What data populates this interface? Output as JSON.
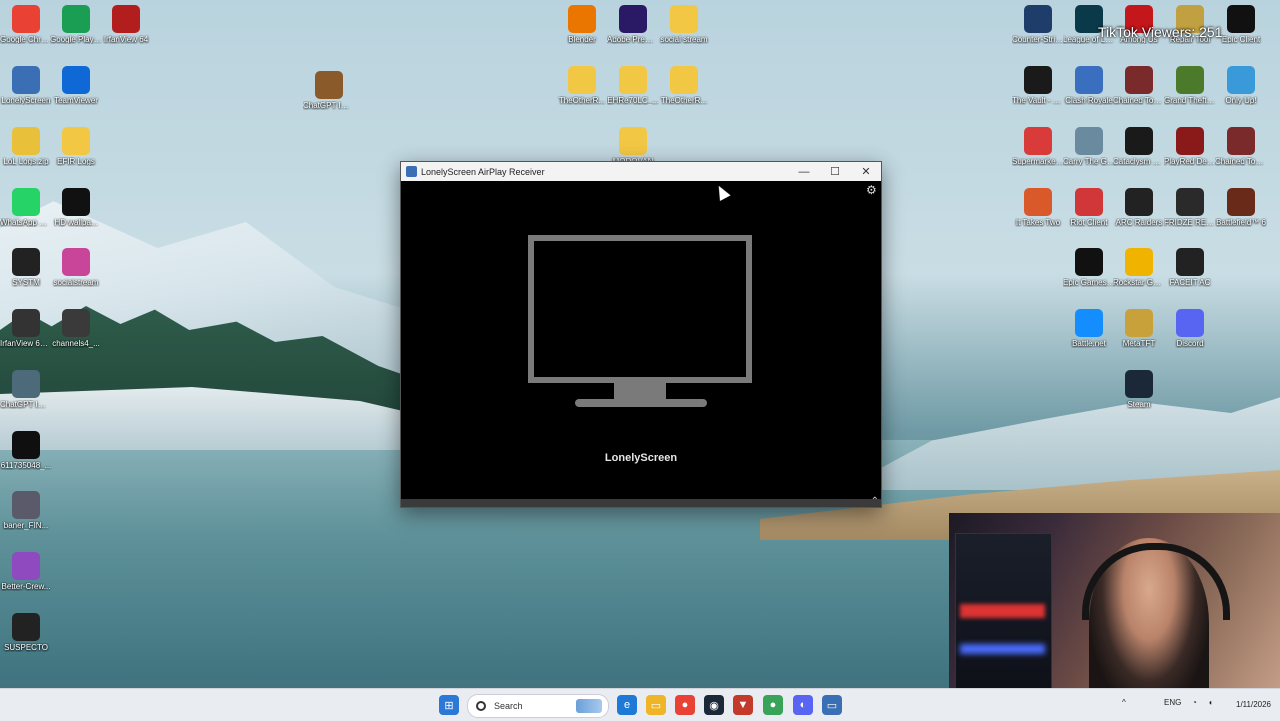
{
  "overlay": {
    "tiktok_viewers": "TikTok Viewers: 251"
  },
  "desktop_icons": [
    {
      "label": "Google Chrome",
      "icon": "chrome-icon",
      "color": "#e94235"
    },
    {
      "label": "Google Play Games",
      "icon": "play-games-icon",
      "color": "#1a9e54"
    },
    {
      "label": "IrfanView 64",
      "icon": "irfanview-icon",
      "color": "#b21e1e"
    },
    {
      "label": "LonelyScreen",
      "icon": "lonelyscreen-icon",
      "color": "#3b6fb5"
    },
    {
      "label": "TeamViewer",
      "icon": "teamviewer-icon",
      "color": "#0e69d6"
    },
    {
      "label": "ChatGPT Image Jan...",
      "icon": "image-file-icon",
      "color": "#8a5a2a"
    },
    {
      "label": "LoL Logs.zip",
      "icon": "zip-folder-icon",
      "color": "#e8c03a"
    },
    {
      "label": "EFIR Logs",
      "icon": "folder-icon",
      "color": "#f2c744"
    },
    {
      "label": "WhatsApp Web",
      "icon": "whatsapp-icon",
      "color": "#25d366"
    },
    {
      "label": "HD wallpa...",
      "icon": "image-file-icon",
      "color": "#111111"
    },
    {
      "label": "SYSTM",
      "icon": "systm-icon",
      "color": "#222222"
    },
    {
      "label": "socialstream",
      "icon": "socialstream-icon",
      "color": "#c9459a"
    },
    {
      "label": "IrfanView 64 Thumbnails",
      "icon": "irfanview-thumbs-icon",
      "color": "#333333"
    },
    {
      "label": "channels4_...",
      "icon": "image-file-icon",
      "color": "#3a3a3a"
    },
    {
      "label": "ChatGPT Image Sep...",
      "icon": "image-file-icon",
      "color": "#4c6a7a"
    },
    {
      "label": "611735048_...",
      "icon": "image-file-icon",
      "color": "#0f0f0f"
    },
    {
      "label": "baner_FIN...",
      "icon": "image-file-icon",
      "color": "#5a5a6a"
    },
    {
      "label": "Better-Crew...",
      "icon": "better-crew-icon",
      "color": "#8f4ac0"
    },
    {
      "label": "SUSPECTO",
      "icon": "suspecto-icon",
      "color": "#222222"
    },
    {
      "label": "Blender",
      "icon": "blender-icon",
      "color": "#ea7600"
    },
    {
      "label": "Adobe Premiere P...",
      "icon": "premiere-icon",
      "color": "#2a1a66"
    },
    {
      "label": "social stream",
      "icon": "folder-icon",
      "color": "#f2c744"
    },
    {
      "label": "TheOtherR...",
      "icon": "folder-icon",
      "color": "#f2c744"
    },
    {
      "label": "EHRe70LC_...",
      "icon": "folder-icon",
      "color": "#f2c744"
    },
    {
      "label": "TheOtherR...",
      "icon": "folder-icon",
      "color": "#f2c744"
    },
    {
      "label": "MODOVAN",
      "icon": "folder-icon",
      "color": "#f2c744"
    },
    {
      "label": "Counter-Stri... 2",
      "icon": "cs2-icon",
      "color": "#1f3d6b"
    },
    {
      "label": "League of Legends",
      "icon": "lol-icon",
      "color": "#0a3a4a"
    },
    {
      "label": "Among Us",
      "icon": "among-us-icon",
      "color": "#c4171c"
    },
    {
      "label": "Repair Tool",
      "icon": "repair-tool-icon",
      "color": "#c0a040"
    },
    {
      "label": "Epic Client",
      "icon": "client-icon",
      "color": "#111111"
    },
    {
      "label": "The Vault - Logic Puzz...",
      "icon": "game-icon",
      "color": "#1a1a1a"
    },
    {
      "label": "Clash Royale",
      "icon": "clash-royale-icon",
      "color": "#3a6fbf"
    },
    {
      "label": "Chained Together",
      "icon": "game-icon",
      "color": "#7a2a2a"
    },
    {
      "label": "Grand Theft Auto V",
      "icon": "gta-icon",
      "color": "#4a7a2a"
    },
    {
      "label": "Only Up!",
      "icon": "game-icon",
      "color": "#3a9ad9"
    },
    {
      "label": "Supermarket Together",
      "icon": "game-icon",
      "color": "#d93a3a"
    },
    {
      "label": "Carry The Glass",
      "icon": "game-icon",
      "color": "#6a8aa0"
    },
    {
      "label": "Cataclysm Classic",
      "icon": "game-icon",
      "color": "#1a1a1a"
    },
    {
      "label": "PlayRed Dead Rede...",
      "icon": "game-icon",
      "color": "#8a1a1a"
    },
    {
      "label": "Chained Together...",
      "icon": "game-icon",
      "color": "#7a2a2a"
    },
    {
      "label": "It Takes Two",
      "icon": "game-icon",
      "color": "#d9592a"
    },
    {
      "label": "Riot Client",
      "icon": "riot-icon",
      "color": "#d13639"
    },
    {
      "label": "ARC Raiders",
      "icon": "game-icon",
      "color": "#222222"
    },
    {
      "label": "FRIDZE RESET STREMIO (1)",
      "icon": "game-icon",
      "color": "#2a2a2a"
    },
    {
      "label": "Battlefield™ 6",
      "icon": "battlefield-icon",
      "color": "#6a2a1a"
    },
    {
      "label": "Epic Games Launcher",
      "icon": "epic-icon",
      "color": "#111111"
    },
    {
      "label": "Rockstar Games...",
      "icon": "rockstar-icon",
      "color": "#f0b400"
    },
    {
      "label": "FACEIT AC",
      "icon": "faceit-icon",
      "color": "#222222"
    },
    {
      "label": "Battle.net",
      "icon": "battlenet-icon",
      "color": "#148eff"
    },
    {
      "label": "MetaTFT",
      "icon": "metatft-icon",
      "color": "#c9a13a"
    },
    {
      "label": "Discord",
      "icon": "discord-icon",
      "color": "#5865f2"
    },
    {
      "label": "Steam",
      "icon": "steam-icon",
      "color": "#1b2838"
    }
  ],
  "window": {
    "title": "LonelyScreen AirPlay Receiver",
    "app_name": "LonelyScreen",
    "minimize": "—",
    "maximize": "☐",
    "close": "✕",
    "settings": "⚙",
    "collapse": "⌃"
  },
  "taskbar": {
    "search_placeholder": "Search",
    "language": "ENG",
    "date": "1/11/2026",
    "tray_chevron": "^"
  }
}
